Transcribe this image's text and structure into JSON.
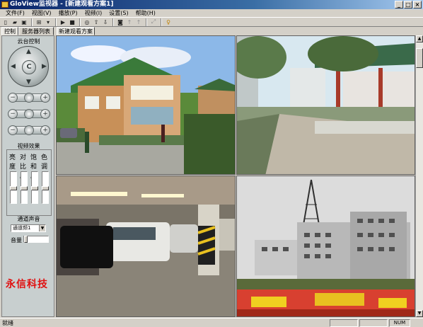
{
  "window": {
    "title": "GloView监视器 - [新建观看方案1]"
  },
  "menu": [
    "文件(F)",
    "视图(V)",
    "播放(P)",
    "视频(I)",
    "设置(S)",
    "帮助(H)"
  ],
  "toolbar_icons": [
    "new-icon",
    "open-icon",
    "save-icon",
    "layout-icon",
    "play-icon",
    "stop-icon",
    "record-icon",
    "upload-icon",
    "download-icon",
    "snapshot-icon",
    "pin-icon",
    "pin-icon",
    "fullscreen-icon",
    "help-icon"
  ],
  "tabs": {
    "control": "控制",
    "server_list": "服务器列表",
    "scheme": "新建观看方案1"
  },
  "panel": {
    "ptz_title": "云台控制",
    "effects_title": "视频效果",
    "effect_labels": [
      "亮度",
      "对比度",
      "饱和度",
      "色调"
    ],
    "channel_sound": "通道声音",
    "channel_select": "通道频1",
    "volume_label": "音量",
    "brand": "永信科技"
  },
  "status": {
    "text": "就绪",
    "num": "NUM"
  },
  "colors": {
    "brand_red": "#e01010",
    "title_blue": "#0a246a"
  }
}
